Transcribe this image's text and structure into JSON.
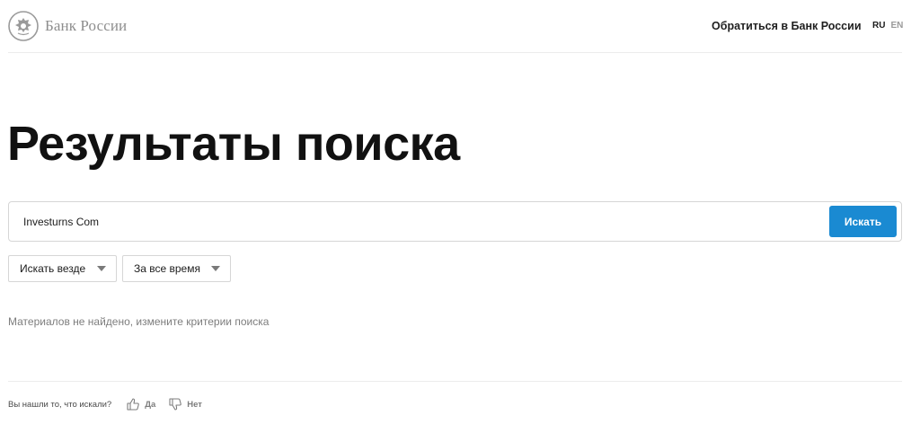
{
  "header": {
    "logo_text": "Банк России",
    "contact_link": "Обратиться в Банк России",
    "lang_active": "RU",
    "lang_inactive": "EN"
  },
  "main": {
    "title": "Результаты поиска",
    "search": {
      "value": "Investurns Com",
      "button_label": "Искать"
    },
    "filters": {
      "where": "Искать везде",
      "time": "За все время"
    },
    "no_results": "Материалов не найдено, измените критерии поиска"
  },
  "feedback": {
    "question": "Вы нашли то, что искали?",
    "yes_label": "Да",
    "no_label": "Нет"
  },
  "colors": {
    "accent": "#1a8ad2",
    "muted_text": "#7d7d7d"
  },
  "icons": {
    "logo": "bank-emblem-icon",
    "like": "thumbs-up-icon",
    "dislike": "thumbs-down-icon",
    "dropdown": "chevron-down-icon"
  }
}
